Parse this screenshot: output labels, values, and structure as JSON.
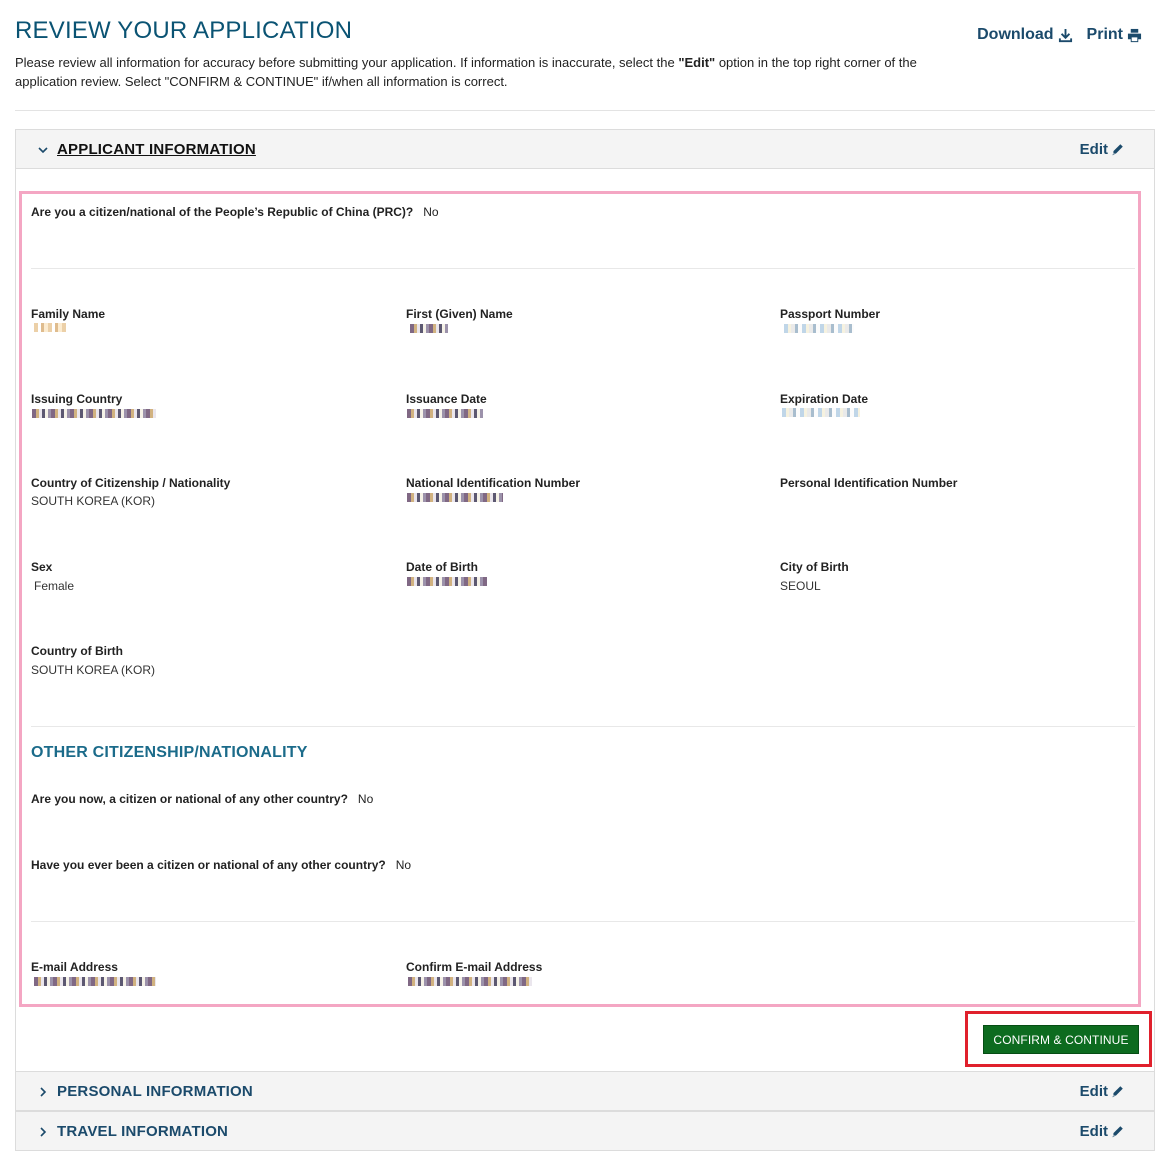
{
  "header": {
    "title": "REVIEW YOUR APPLICATION",
    "intro_pre": "Please review all information for accuracy before submitting your application. If information is inaccurate, select the ",
    "intro_bold": "\"Edit\"",
    "intro_post": " option in the top right corner of the application review. Select \"CONFIRM & CONTINUE\" if/when all information is correct.",
    "download_label": "Download",
    "print_label": "Print"
  },
  "sections": [
    {
      "title": "APPLICANT INFORMATION",
      "edit_label": "Edit",
      "expanded": true
    },
    {
      "title": "PERSONAL INFORMATION",
      "edit_label": "Edit",
      "expanded": false
    },
    {
      "title": "TRAVEL INFORMATION",
      "edit_label": "Edit",
      "expanded": false
    }
  ],
  "applicant": {
    "prc_question": "Are you a citizen/national of the People’s Republic of China (PRC)?",
    "prc_answer": "No",
    "fields": {
      "family_name": "Family Name",
      "first_name": "First (Given) Name",
      "passport_number": "Passport Number",
      "issuing_country": "Issuing Country",
      "issuance_date": "Issuance Date",
      "expiration_date": "Expiration Date",
      "citizenship": "Country of Citizenship / Nationality",
      "citizenship_value": "SOUTH KOREA (KOR)",
      "national_id": "National Identification Number",
      "personal_id": "Personal Identification Number",
      "sex": "Sex",
      "sex_value": "Female",
      "dob": "Date of Birth",
      "city_of_birth": "City of Birth",
      "city_of_birth_value": "SEOUL",
      "country_of_birth": "Country of Birth",
      "country_of_birth_value": "SOUTH KOREA (KOR)",
      "email": "E-mail Address",
      "confirm_email": "Confirm E-mail Address"
    },
    "other_citizenship": {
      "heading": "OTHER CITIZENSHIP/NATIONALITY",
      "q1": "Are you now, a citizen or national of any other country?",
      "a1": "No",
      "q2": "Have you ever been a citizen or national of any other country?",
      "a2": "No"
    }
  },
  "actions": {
    "confirm_label": "CONFIRM & CONTINUE"
  },
  "colors": {
    "accent": "#0a5373",
    "confirm": "#0d6b1f",
    "highlight_pink": "#f4a6c3",
    "highlight_red": "#e0202c"
  }
}
